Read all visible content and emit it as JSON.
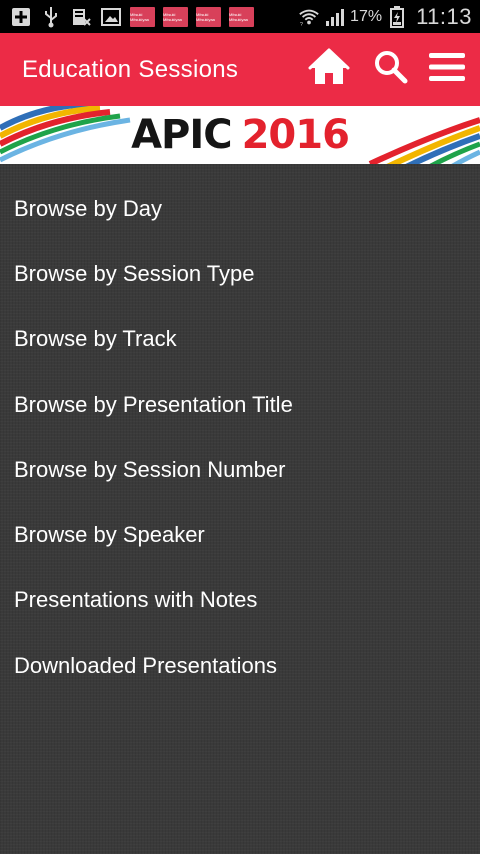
{
  "status_bar": {
    "icons": [
      "add-icon",
      "usb-icon",
      "sd-card-icon",
      "image-icon"
    ],
    "thumb_label": "Mitsuki Mitsukiyaa",
    "battery": "17%",
    "time": "11:13"
  },
  "app_bar": {
    "title": "Education Sessions",
    "icons": [
      "home-icon",
      "search-icon",
      "menu-icon"
    ]
  },
  "banner": {
    "word": "APIC",
    "year": "2016"
  },
  "menu": {
    "items": [
      {
        "label": "Browse by Day"
      },
      {
        "label": "Browse by Session Type"
      },
      {
        "label": "Browse by Track"
      },
      {
        "label": "Browse by Presentation Title"
      },
      {
        "label": "Browse by Session Number"
      },
      {
        "label": "Browse by Speaker"
      },
      {
        "label": "Presentations with Notes"
      },
      {
        "label": "Downloaded Presentations"
      }
    ]
  },
  "colors": {
    "app_bar": "#ec2b46",
    "content_bg": "#3a3a3a",
    "banner_year": "#e3222d"
  }
}
